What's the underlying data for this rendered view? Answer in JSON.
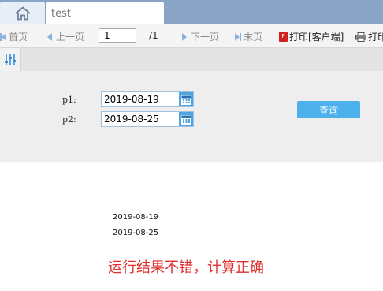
{
  "tabs": {
    "home_icon": "home-icon",
    "active_tab_label": "test"
  },
  "toolbar": {
    "first_label": "首页",
    "prev_label": "上一页",
    "page_value": "1",
    "page_total": "/1",
    "next_label": "下一页",
    "last_label": "末页",
    "print_client_label": "打印[客户端]",
    "print_label": "打印"
  },
  "params": {
    "icon": "sliders-icon",
    "p1_label": "p1:",
    "p1_value": "2019-08-19",
    "p2_label": "p2:",
    "p2_value": "2019-08-25",
    "calendar_icon": "calendar-icon",
    "query_label": "查询"
  },
  "report": {
    "line1": "2019-08-19",
    "line2": "2019-08-25",
    "result_text": "运行结果不错，计算正确"
  },
  "colors": {
    "tabbar": "#8aa4c8",
    "accent": "#4db1ec",
    "result_text": "#e03030"
  }
}
